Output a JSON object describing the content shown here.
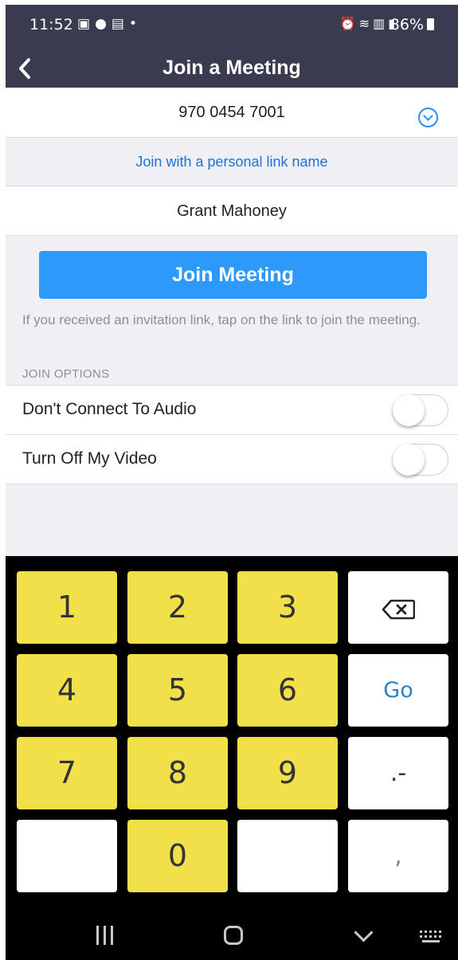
{
  "status_bar": {
    "time": "11:52",
    "left_icons": [
      "gallery-icon",
      "bulb-icon",
      "fox-news-icon",
      "dot-icon"
    ],
    "right_icons": [
      "alarm-icon",
      "wifi-call-icon",
      "volte-icon",
      "signal-icon"
    ],
    "battery": "86%"
  },
  "header": {
    "title": "Join a Meeting"
  },
  "meeting": {
    "id": "970 0454 7001"
  },
  "personal_link": "Join with a personal link name",
  "name": {
    "value": "Grant Mahoney"
  },
  "join_button": "Join Meeting",
  "hint": "If you received an invitation link, tap on the link to join the meeting.",
  "options": {
    "header": "JOIN OPTIONS",
    "items": [
      {
        "label": "Don't Connect To Audio",
        "on": false
      },
      {
        "label": "Turn Off My Video",
        "on": false
      }
    ]
  },
  "keyboard": {
    "keys": [
      "1",
      "2",
      "3",
      "4",
      "5",
      "6",
      "7",
      "8",
      "9",
      "0"
    ],
    "go": "Go",
    "dot_dash": ".-",
    "comma": ","
  },
  "colors": {
    "header_bg": "#3b3b4f",
    "accent": "#2d99fa",
    "link": "#1f72d6",
    "key_yellow": "#f1e049"
  }
}
